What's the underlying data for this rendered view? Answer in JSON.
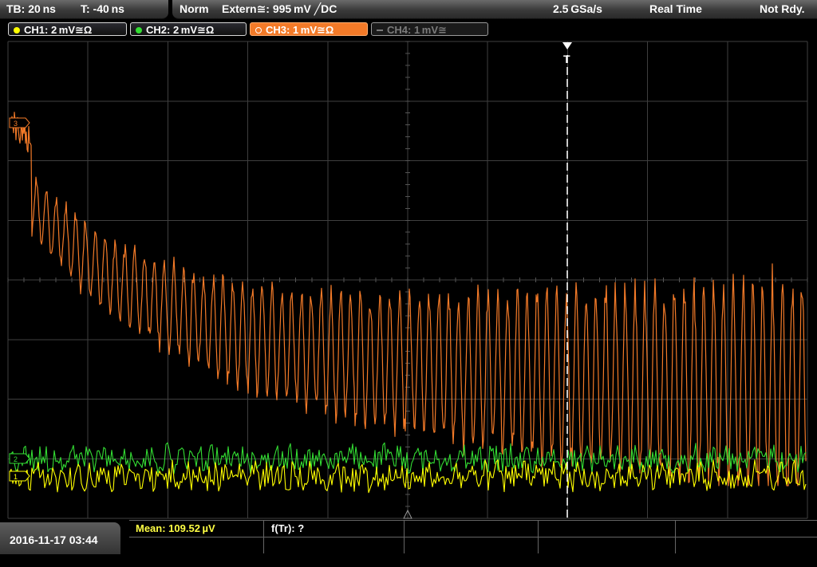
{
  "topbar": {
    "timebase": "TB: 20 ns",
    "trigger_time": "T: -40 ns",
    "trigger_mode": "Norm",
    "trigger_source": "Extern≅: 995 mV ╱DC",
    "sample_rate": "2.5 GSa/s",
    "acq_mode": "Real Time",
    "status": "Not Rdy."
  },
  "channels": [
    {
      "label": "CH1: 2 mV≅Ω",
      "color": "#ffff00",
      "active": true
    },
    {
      "label": "CH2: 2 mV≅Ω",
      "color": "#33dd33",
      "active": true
    },
    {
      "label": "CH3: 1 mV≅Ω",
      "color": "#f37a28",
      "active": true
    },
    {
      "label": "CH4: 1 mV≅",
      "color": "#7b7b7b",
      "active": false
    }
  ],
  "markers": {
    "trigger": "T",
    "ch3": "3",
    "ch2": "2",
    "ch1": "1"
  },
  "measurements": {
    "mean": "Mean: 109.52 µV",
    "ftr": "f(Tr): ?"
  },
  "datetime": "2016-11-17 03:44",
  "colors": {
    "grid": "#3f3f3f",
    "ch1": "#ffff00",
    "ch2": "#33dd33",
    "ch3": "#f37a28",
    "mean_text": "#ffff44"
  }
}
